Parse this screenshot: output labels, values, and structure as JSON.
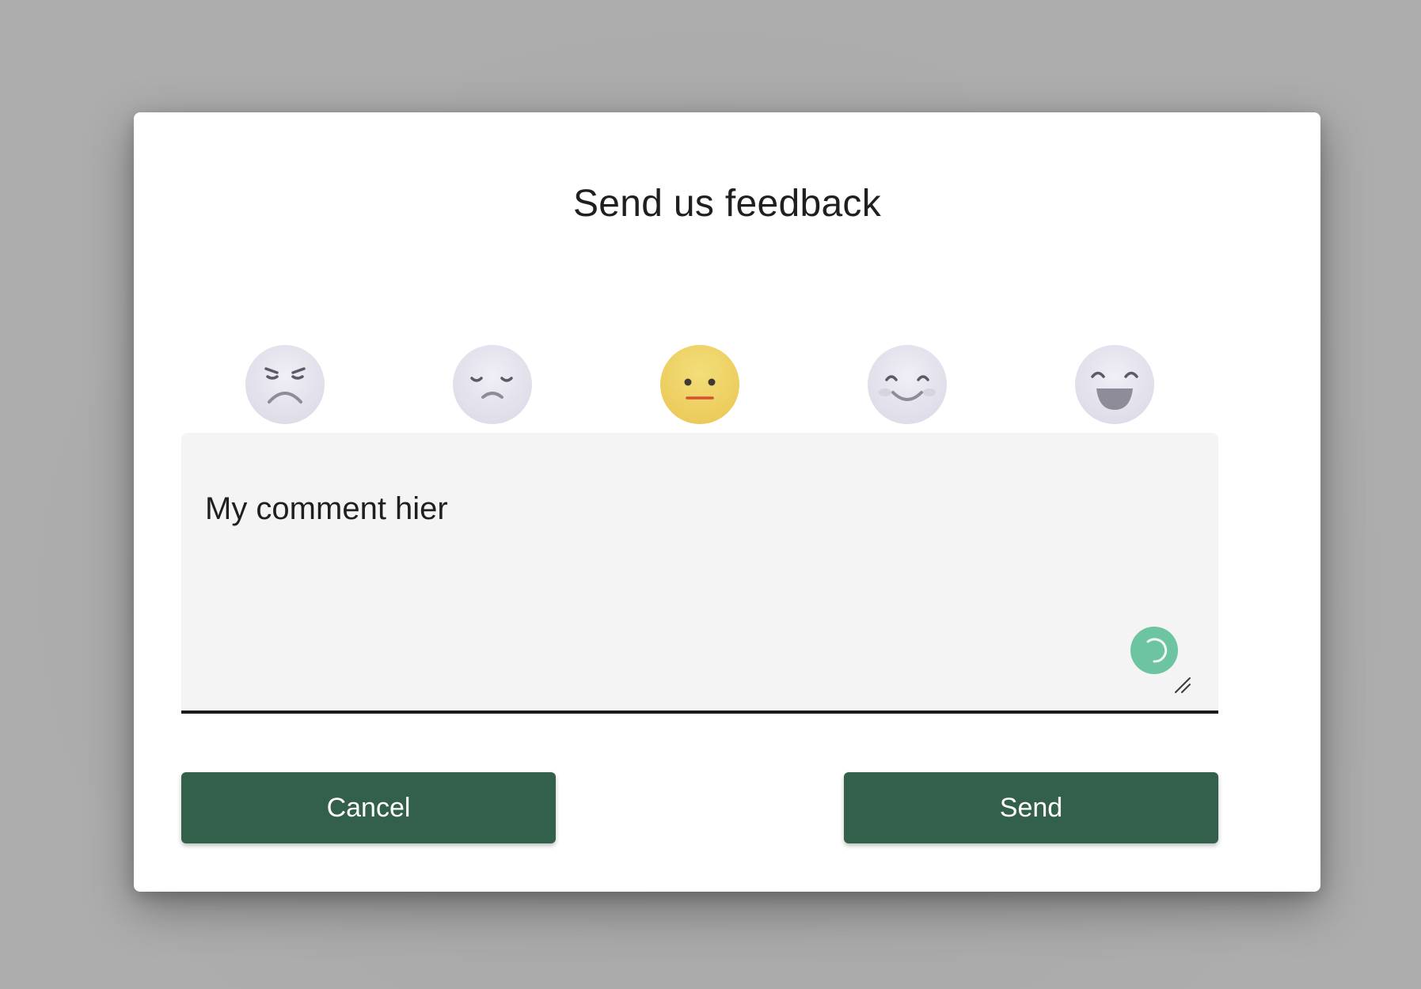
{
  "dialog": {
    "title": "Send us feedback"
  },
  "rating": {
    "options": [
      {
        "name": "angry",
        "selected": false
      },
      {
        "name": "sad",
        "selected": false
      },
      {
        "name": "neutral",
        "selected": true
      },
      {
        "name": "happy",
        "selected": false
      },
      {
        "name": "very-happy",
        "selected": false
      }
    ],
    "colors": {
      "inactive": "#e9e8f1",
      "active": "#f2d86d"
    }
  },
  "comment": {
    "value": "My comment hier"
  },
  "buttons": {
    "cancel_label": "Cancel",
    "send_label": "Send"
  },
  "colors": {
    "button_bg": "#32604a",
    "loader": "#6cc4a0"
  }
}
